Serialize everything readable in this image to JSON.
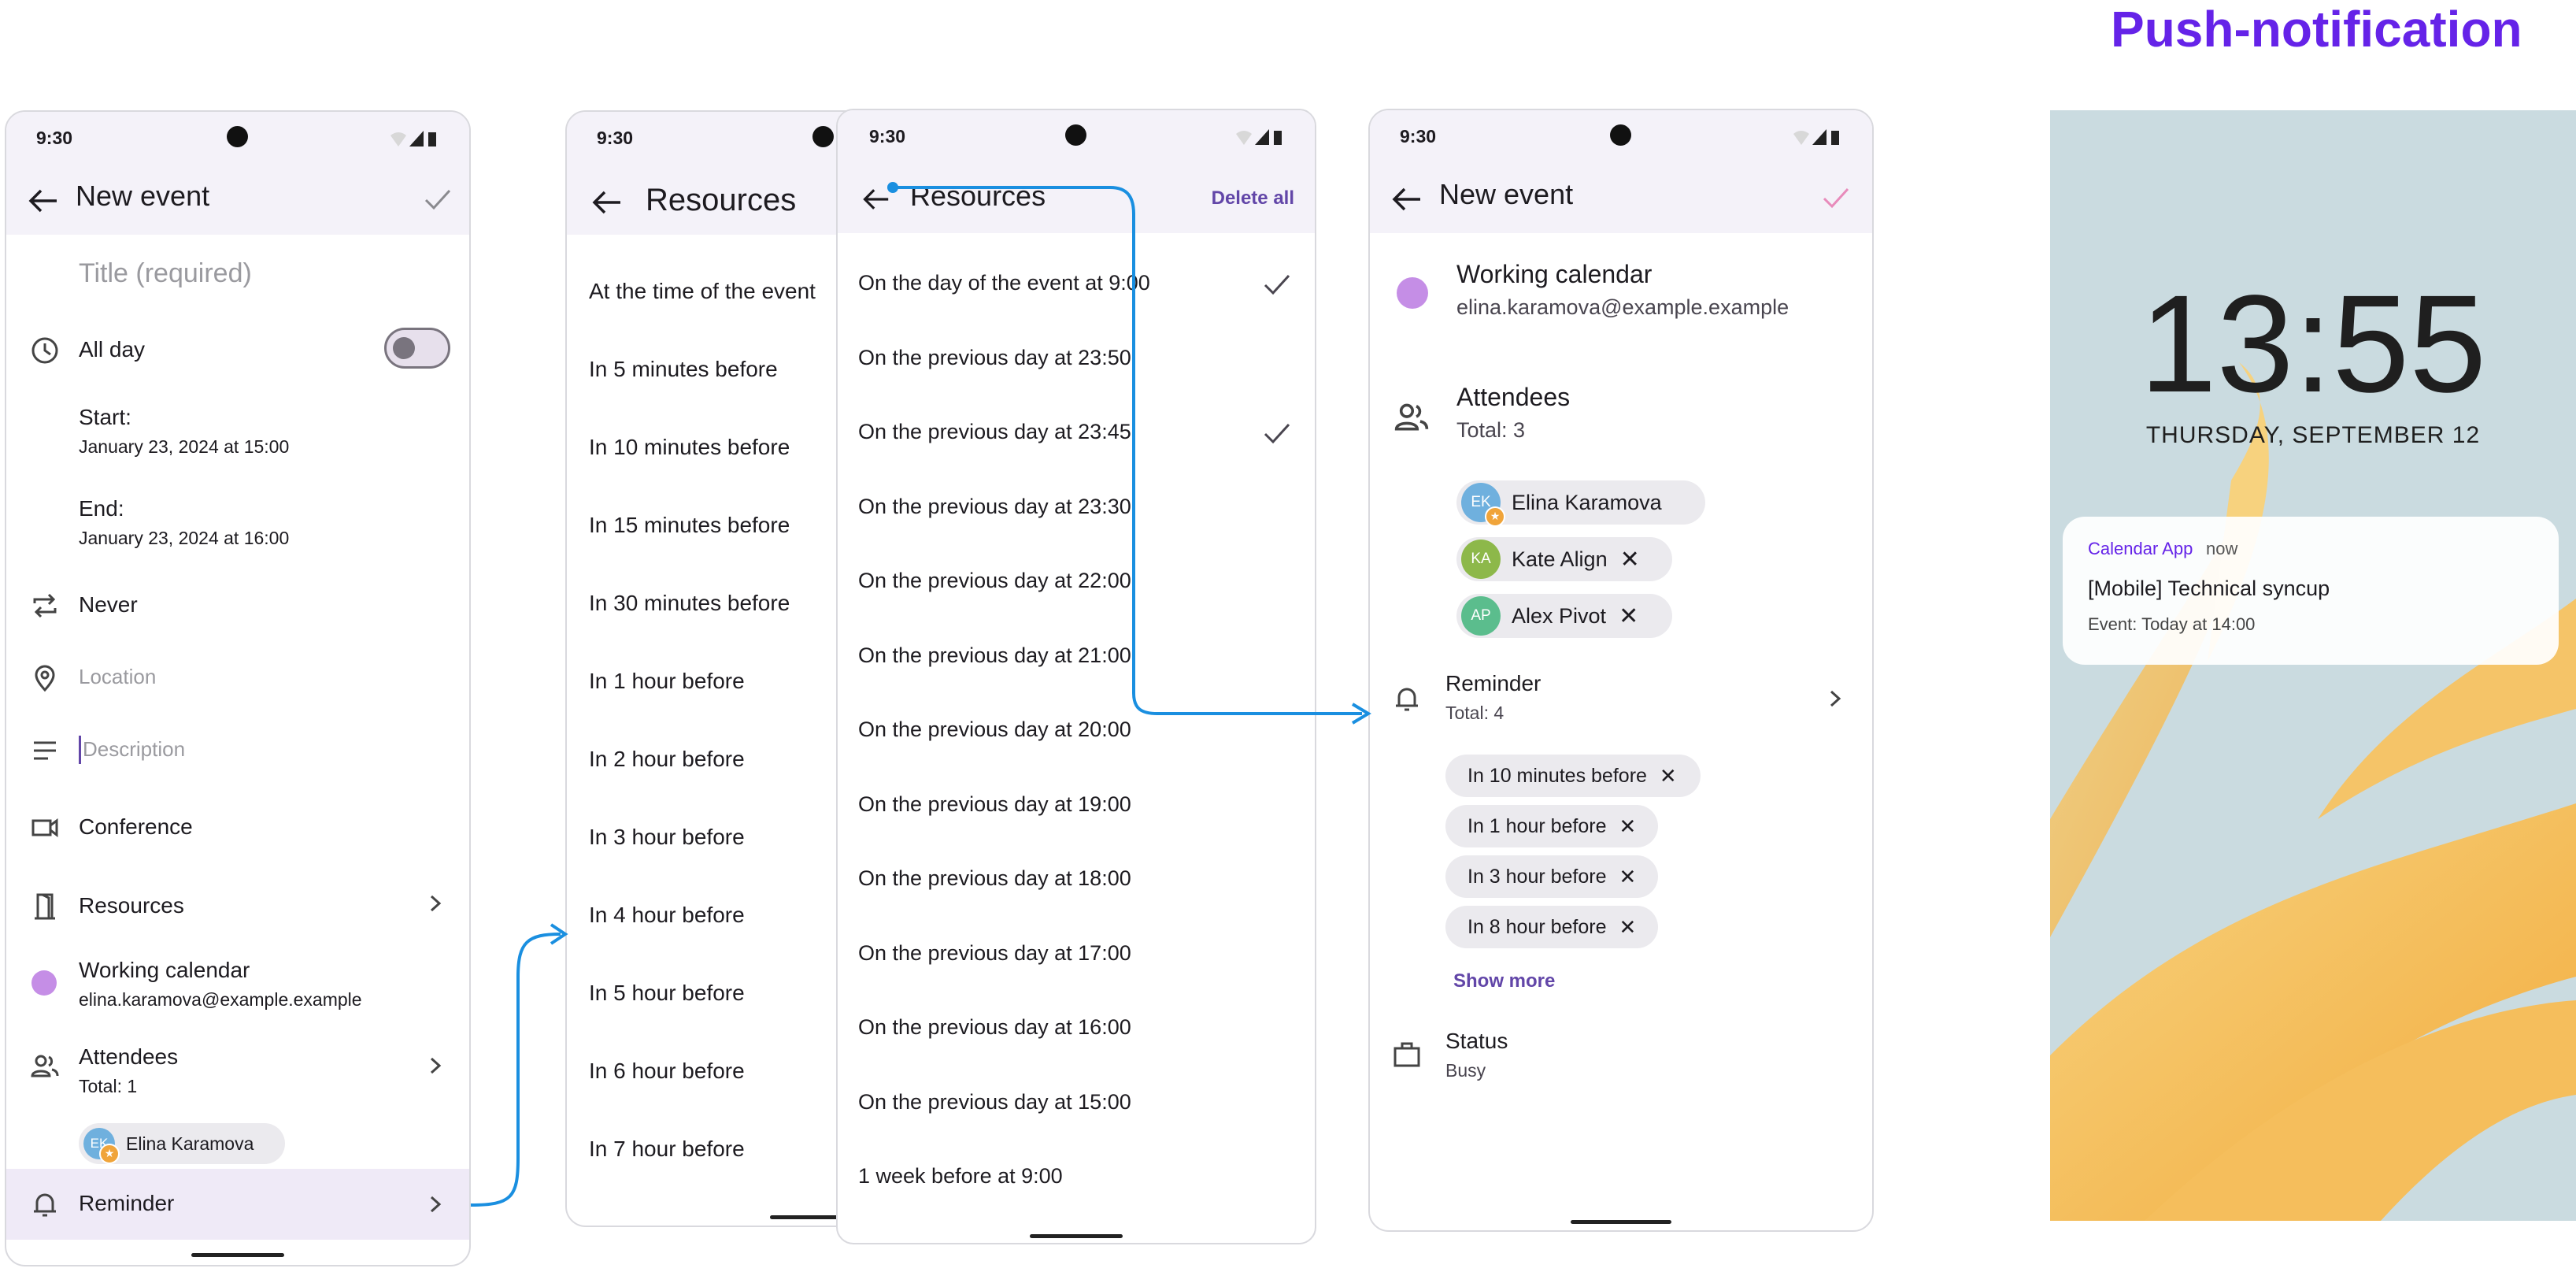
{
  "heading": "Push-notification",
  "status_time": "9:30",
  "screen1": {
    "title": "New event",
    "title_placeholder": "Title (required)",
    "all_day": "All day",
    "start_label": "Start:",
    "start_value": "January 23, 2024 at 15:00",
    "end_label": "End:",
    "end_value": "January 23, 2024 at 16:00",
    "repeat": "Never",
    "location_placeholder": "Location",
    "description_placeholder": "Description",
    "conference": "Conference",
    "resources": "Resources",
    "calendar_name": "Working calendar",
    "calendar_email": "elina.karamova@example.example",
    "attendees": "Attendees",
    "attendees_total": "Total: 1",
    "attendee_chip_initials": "EK",
    "attendee_chip_name": "Elina Karamova",
    "reminder": "Reminder"
  },
  "screen2": {
    "title": "Resources",
    "items": [
      "At the time of the event",
      "In 5 minutes before",
      "In 10 minutes before",
      "In 15 minutes before",
      "In 30 minutes before",
      "In 1 hour before",
      "In 2 hour before",
      "In 3 hour before",
      "In 4 hour before",
      "In 5 hour before",
      "In 6 hour before",
      "In 7 hour before"
    ]
  },
  "screen3": {
    "title": "Resources",
    "action": "Delete all",
    "items": [
      "On the day of the event at 9:00",
      "On the previous day at 23:50",
      "On the previous day at 23:45",
      "On the previous day at 23:30",
      "On the previous day at 22:00",
      "On the previous day at 21:00",
      "On the previous day at 20:00",
      "On the previous day at 19:00",
      "On the previous day at 18:00",
      "On the previous day at 17:00",
      "On the previous day at 16:00",
      "On the previous day at 15:00",
      "1 week before at 9:00"
    ]
  },
  "screen4": {
    "title": "New event",
    "calendar_name": "Working calendar",
    "calendar_email": "elina.karamova@example.example",
    "attendees": "Attendees",
    "attendees_total": "Total: 3",
    "attendees_list": [
      {
        "initials": "EK",
        "name": "Elina Karamova",
        "color": "#6fb0de"
      },
      {
        "initials": "KA",
        "name": "Kate Align",
        "color": "#8db84a"
      },
      {
        "initials": "AP",
        "name": "Alex Pivot",
        "color": "#5bbd8d"
      }
    ],
    "reminder": "Reminder",
    "reminder_total": "Total: 4",
    "reminders": [
      "In 10 minutes before",
      "In 1 hour before",
      "In 3 hour before",
      "In 8 hour before"
    ],
    "show_more": "Show more",
    "status_label": "Status",
    "status_value": "Busy"
  },
  "lockscreen": {
    "clock": "13:55",
    "date": "THURSDAY, SEPTEMBER 12",
    "app": "Calendar App",
    "when": "now",
    "notif_title": "[Mobile] Technical syncup",
    "notif_body": "Event: Today at 14:00"
  },
  "colors": {
    "accent": "#6523e8",
    "arrow": "#1a8fe0",
    "appbar": "#f4f2f9",
    "calendar_dot": "#c58ee6",
    "link": "#6246a8"
  }
}
